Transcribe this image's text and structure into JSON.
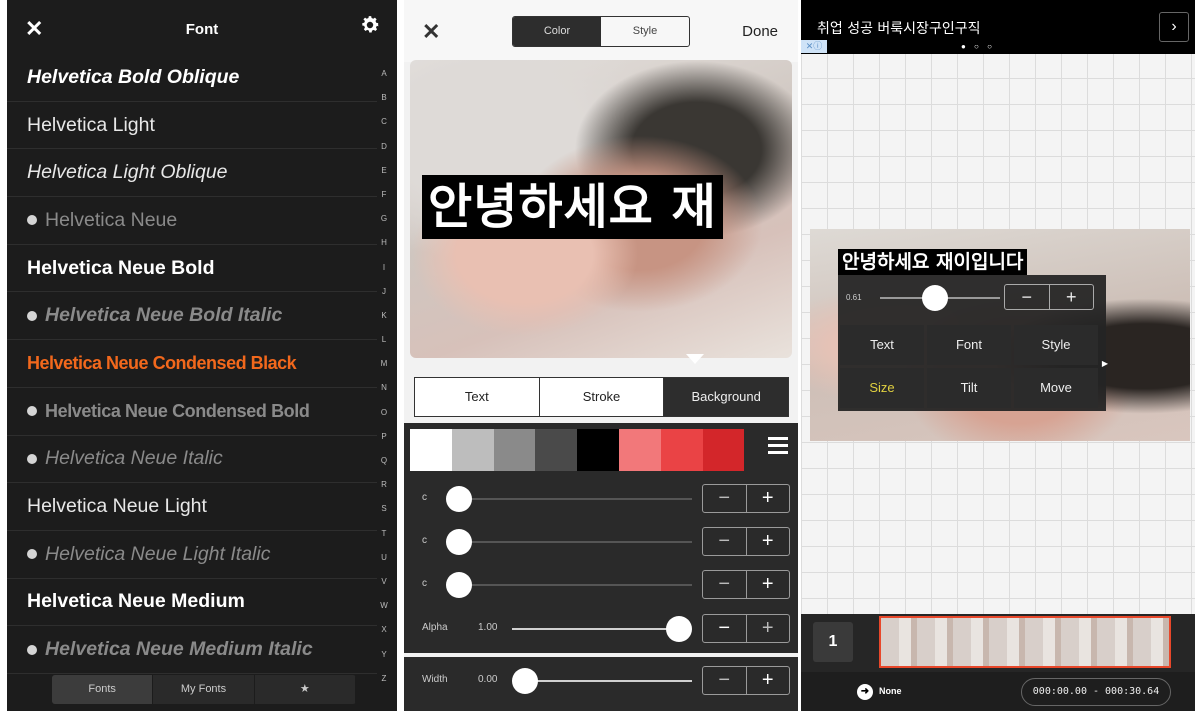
{
  "font_panel": {
    "title": "Font",
    "fonts": [
      {
        "label": "Helvetica Bold Oblique",
        "style": "bold italic",
        "dot": false,
        "dim": false
      },
      {
        "label": "Helvetica Light",
        "style": "light",
        "dot": false,
        "dim": false
      },
      {
        "label": "Helvetica Light Oblique",
        "style": "light italic",
        "dot": false,
        "dim": false
      },
      {
        "label": "Helvetica Neue",
        "style": "regular",
        "dot": true,
        "dim": true
      },
      {
        "label": "Helvetica Neue Bold",
        "style": "bold",
        "dot": false,
        "dim": false
      },
      {
        "label": "Helvetica Neue Bold Italic",
        "style": "bold italic",
        "dot": true,
        "dim": true
      },
      {
        "label": "Helvetica Neue Condensed Black",
        "style": "selected",
        "dot": false,
        "dim": false
      },
      {
        "label": "Helvetica Neue Condensed Bold",
        "style": "cond",
        "dot": true,
        "dim": true
      },
      {
        "label": "Helvetica Neue Italic",
        "style": "italic",
        "dot": true,
        "dim": true
      },
      {
        "label": "Helvetica Neue Light",
        "style": "light",
        "dot": false,
        "dim": false
      },
      {
        "label": "Helvetica Neue Light Italic",
        "style": "italic",
        "dot": true,
        "dim": true
      },
      {
        "label": "Helvetica Neue Medium",
        "style": "bold",
        "dot": false,
        "dim": false
      },
      {
        "label": "Helvetica Neue Medium Italic",
        "style": "bold italic",
        "dot": true,
        "dim": true
      }
    ],
    "alphabet": [
      "A",
      "B",
      "C",
      "D",
      "E",
      "F",
      "G",
      "H",
      "I",
      "J",
      "K",
      "L",
      "M",
      "N",
      "O",
      "P",
      "Q",
      "R",
      "S",
      "T",
      "U",
      "V",
      "W",
      "X",
      "Y",
      "Z"
    ],
    "tabs": {
      "fonts": "Fonts",
      "my_fonts": "My Fonts",
      "star": "★"
    },
    "accent_color": "#f2681c"
  },
  "color_panel": {
    "segment": {
      "color": "Color",
      "style": "Style"
    },
    "done": "Done",
    "caption": "안녕하세요 재",
    "tabs": {
      "text": "Text",
      "stroke": "Stroke",
      "background": "Background"
    },
    "swatches": [
      "#ffffff",
      "#bdbdbd",
      "#8a8a8a",
      "#4a4a4a",
      "#000000",
      "#f2787a",
      "#ea4345",
      "#d3262a"
    ],
    "sliders": [
      {
        "label": "c",
        "value": ""
      },
      {
        "label": "c",
        "value": ""
      },
      {
        "label": "c",
        "value": ""
      },
      {
        "label": "Alpha",
        "value": "1.00"
      }
    ],
    "width": {
      "label": "Width",
      "value": "0.00"
    },
    "stepper": {
      "minus": "−",
      "plus": "+"
    }
  },
  "video_panel": {
    "ad_text": "취업 성공 버룩시장구인구직",
    "ad_arrow": "›",
    "ad_dots": "● ○ ○",
    "ad_close": "✕ⓘ",
    "caption": "안녕하세요 재이입니다",
    "size_value": "0.61",
    "buttons": [
      "Text",
      "Font",
      "Style",
      "Size",
      "Tilt",
      "Move"
    ],
    "active_button": "Size",
    "clip_number": "1",
    "transition": "None",
    "time_range": "000:00.00 - 000:30.64"
  }
}
